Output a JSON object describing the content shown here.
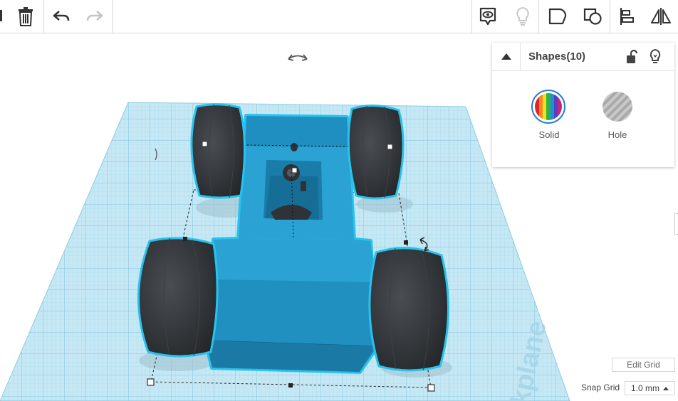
{
  "toolbar": {
    "left_buttons": [
      {
        "name": "delete",
        "icon": "trash-icon"
      },
      {
        "name": "undo",
        "icon": "undo-arrow-icon"
      },
      {
        "name": "redo",
        "icon": "redo-arrow-icon",
        "disabled": true
      }
    ],
    "right_buttons": [
      {
        "name": "show-all",
        "icon": "eye-bubble-icon"
      },
      {
        "name": "notes",
        "icon": "lightbulb-icon",
        "disabled": true
      },
      {
        "name": "group",
        "icon": "group-shapes-icon"
      },
      {
        "name": "ungroup",
        "icon": "ungroup-shapes-icon"
      },
      {
        "name": "align",
        "icon": "align-icon"
      },
      {
        "name": "mirror",
        "icon": "mirror-icon"
      }
    ]
  },
  "shapes_panel": {
    "title": "Shapes(10)",
    "solid_label": "Solid",
    "hole_label": "Hole"
  },
  "workplane": {
    "watermark": "kplane",
    "edit_grid_label": "Edit Grid",
    "snap_grid_label": "Snap Grid",
    "snap_grid_value": "1.0 mm"
  },
  "colors": {
    "workplane": "#bfe3f0",
    "grid_line": "#8ccbe2",
    "body_blue": "#2aa3d4",
    "selection_outline": "#27c3ee",
    "tire": "#2f3236"
  }
}
